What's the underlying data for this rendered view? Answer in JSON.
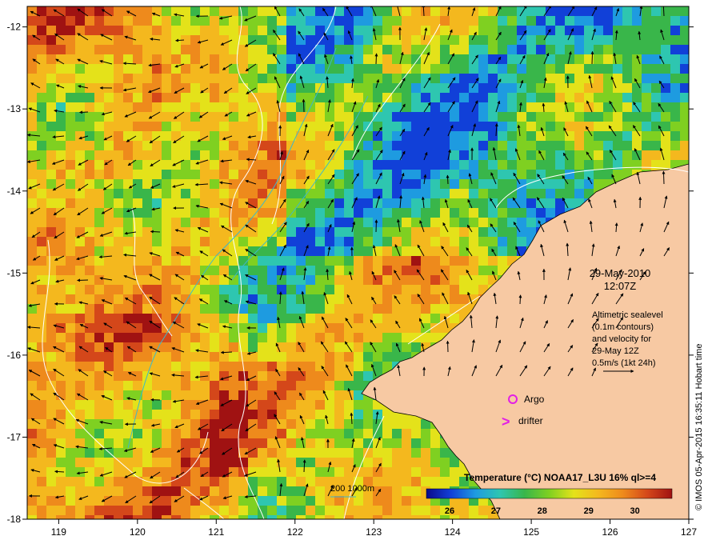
{
  "axes": {
    "x_ticks": [
      "119",
      "120",
      "121",
      "122",
      "123",
      "124",
      "125",
      "126",
      "127"
    ],
    "y_ticks": [
      "-12",
      "-13",
      "-14",
      "-15",
      "-16",
      "-17",
      "-18"
    ]
  },
  "annotation": {
    "date": "29-May-2010",
    "time": "12:07Z",
    "alt_lines": [
      "Altimetric sealevel",
      "(0.1m contours)",
      "and velocity for",
      "29-May 12Z",
      "0.5m/s (1kt 24h)"
    ]
  },
  "legend": {
    "argo_label": "Argo",
    "drifter_symbol": ">",
    "drifter_label": "drifter",
    "depth_label": "200  1000m"
  },
  "colorbar": {
    "title": "Temperature (°C) NOAA17_L3U 16% ql>=4",
    "ticks": [
      "26",
      "27",
      "28",
      "29",
      "30"
    ],
    "colors": [
      "#0b0a8a",
      "#1140d8",
      "#1e9be0",
      "#2ec6b0",
      "#39b64a",
      "#7fd021",
      "#e4e21a",
      "#f4b81e",
      "#ee8a1c",
      "#d4471a",
      "#a01212"
    ]
  },
  "credit": "© IMOS 05-Apr-2015 16:35:11 Hobart time",
  "colors": {
    "land": "#f7c9a3",
    "contour": "#ffffff",
    "isobath": "#3fb7c8",
    "argo": "#e21ee6",
    "drifter": "#e21ee6"
  }
}
